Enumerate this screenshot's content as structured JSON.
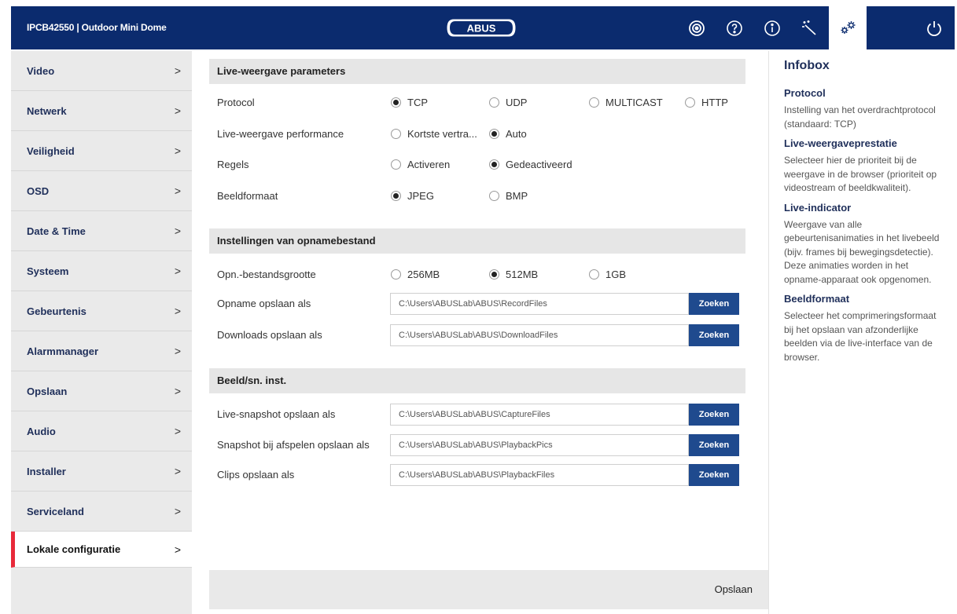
{
  "header": {
    "title": "IPCB42550  |  Outdoor Mini Dome",
    "logo_text": "ABUS",
    "buttons": [
      {
        "icon": "live-view-icon"
      },
      {
        "icon": "help-icon"
      },
      {
        "icon": "info-icon"
      },
      {
        "icon": "installer-wand-icon"
      },
      {
        "icon": "settings-gears-icon"
      },
      {
        "icon": "power-icon"
      }
    ],
    "colors": {
      "bar": "#0b2b6e",
      "active": "#ffffff",
      "accent": "#e8293a"
    }
  },
  "sidebar": {
    "items": [
      {
        "label": "Video"
      },
      {
        "label": "Netwerk"
      },
      {
        "label": "Veiligheid"
      },
      {
        "label": "OSD"
      },
      {
        "label": "Date & Time"
      },
      {
        "label": "Systeem"
      },
      {
        "label": "Gebeurtenis"
      },
      {
        "label": "Alarmmanager"
      },
      {
        "label": "Opslaan"
      },
      {
        "label": "Audio"
      },
      {
        "label": "Installer"
      },
      {
        "label": "Serviceland"
      },
      {
        "label": "Lokale configuratie",
        "active": true
      }
    ],
    "chevron": ">"
  },
  "main": {
    "live": {
      "heading": "Live-weergave parameters",
      "protocol": {
        "label": "Protocol",
        "options": [
          "TCP",
          "UDP",
          "MULTICAST",
          "HTTP"
        ],
        "selected": "TCP"
      },
      "performance": {
        "label": "Live-weergave performance",
        "options": [
          "Kortste vertra...",
          "Auto"
        ],
        "selected": "Auto"
      },
      "rules": {
        "label": "Regels",
        "options": [
          "Activeren",
          "Gedeactiveerd"
        ],
        "selected": "Gedeactiveerd"
      },
      "format": {
        "label": "Beeldformaat",
        "options": [
          "JPEG",
          "BMP"
        ],
        "selected": "JPEG"
      }
    },
    "record": {
      "heading": "Instellingen van opnamebestand",
      "size": {
        "label": "Opn.-bestandsgrootte",
        "options": [
          "256MB",
          "512MB",
          "1GB"
        ],
        "selected": "512MB"
      },
      "record_path": {
        "label": "Opname opslaan als",
        "value": "C:\\Users\\ABUSLab\\ABUS\\RecordFiles"
      },
      "download_path": {
        "label": "Downloads opslaan als",
        "value": "C:\\Users\\ABUSLab\\ABUS\\DownloadFiles"
      }
    },
    "snap": {
      "heading": "Beeld/sn. inst.",
      "live_snapshot": {
        "label": "Live-snapshot opslaan als",
        "value": "C:\\Users\\ABUSLab\\ABUS\\CaptureFiles"
      },
      "playback_snapshot": {
        "label": "Snapshot bij afspelen opslaan als",
        "value": "C:\\Users\\ABUSLab\\ABUS\\PlaybackPics"
      },
      "clips": {
        "label": "Clips opslaan als",
        "value": "C:\\Users\\ABUSLab\\ABUS\\PlaybackFiles"
      }
    },
    "browse_label": "Zoeken",
    "save_label": "Opslaan"
  },
  "infobox": {
    "title": "Infobox",
    "sections": [
      {
        "heading": "Protocol",
        "text": "Instelling van het overdrachtprotocol (standaard: TCP)"
      },
      {
        "heading": "Live-weergaveprestatie",
        "text": "Selecteer hier de prioriteit bij de weergave in de browser (prioriteit op videostream of beeldkwaliteit)."
      },
      {
        "heading": "Live-indicator",
        "text": "Weergave van alle gebeurtenisanimaties in het livebeeld (bijv. frames bij bewegingsdetectie). Deze animaties worden in het opname-apparaat ook opgenomen."
      },
      {
        "heading": "Beeldformaat",
        "text": "Selecteer het comprimeringsformaat bij het opslaan van afzonderlijke beelden via de live-interface van de browser."
      }
    ]
  }
}
